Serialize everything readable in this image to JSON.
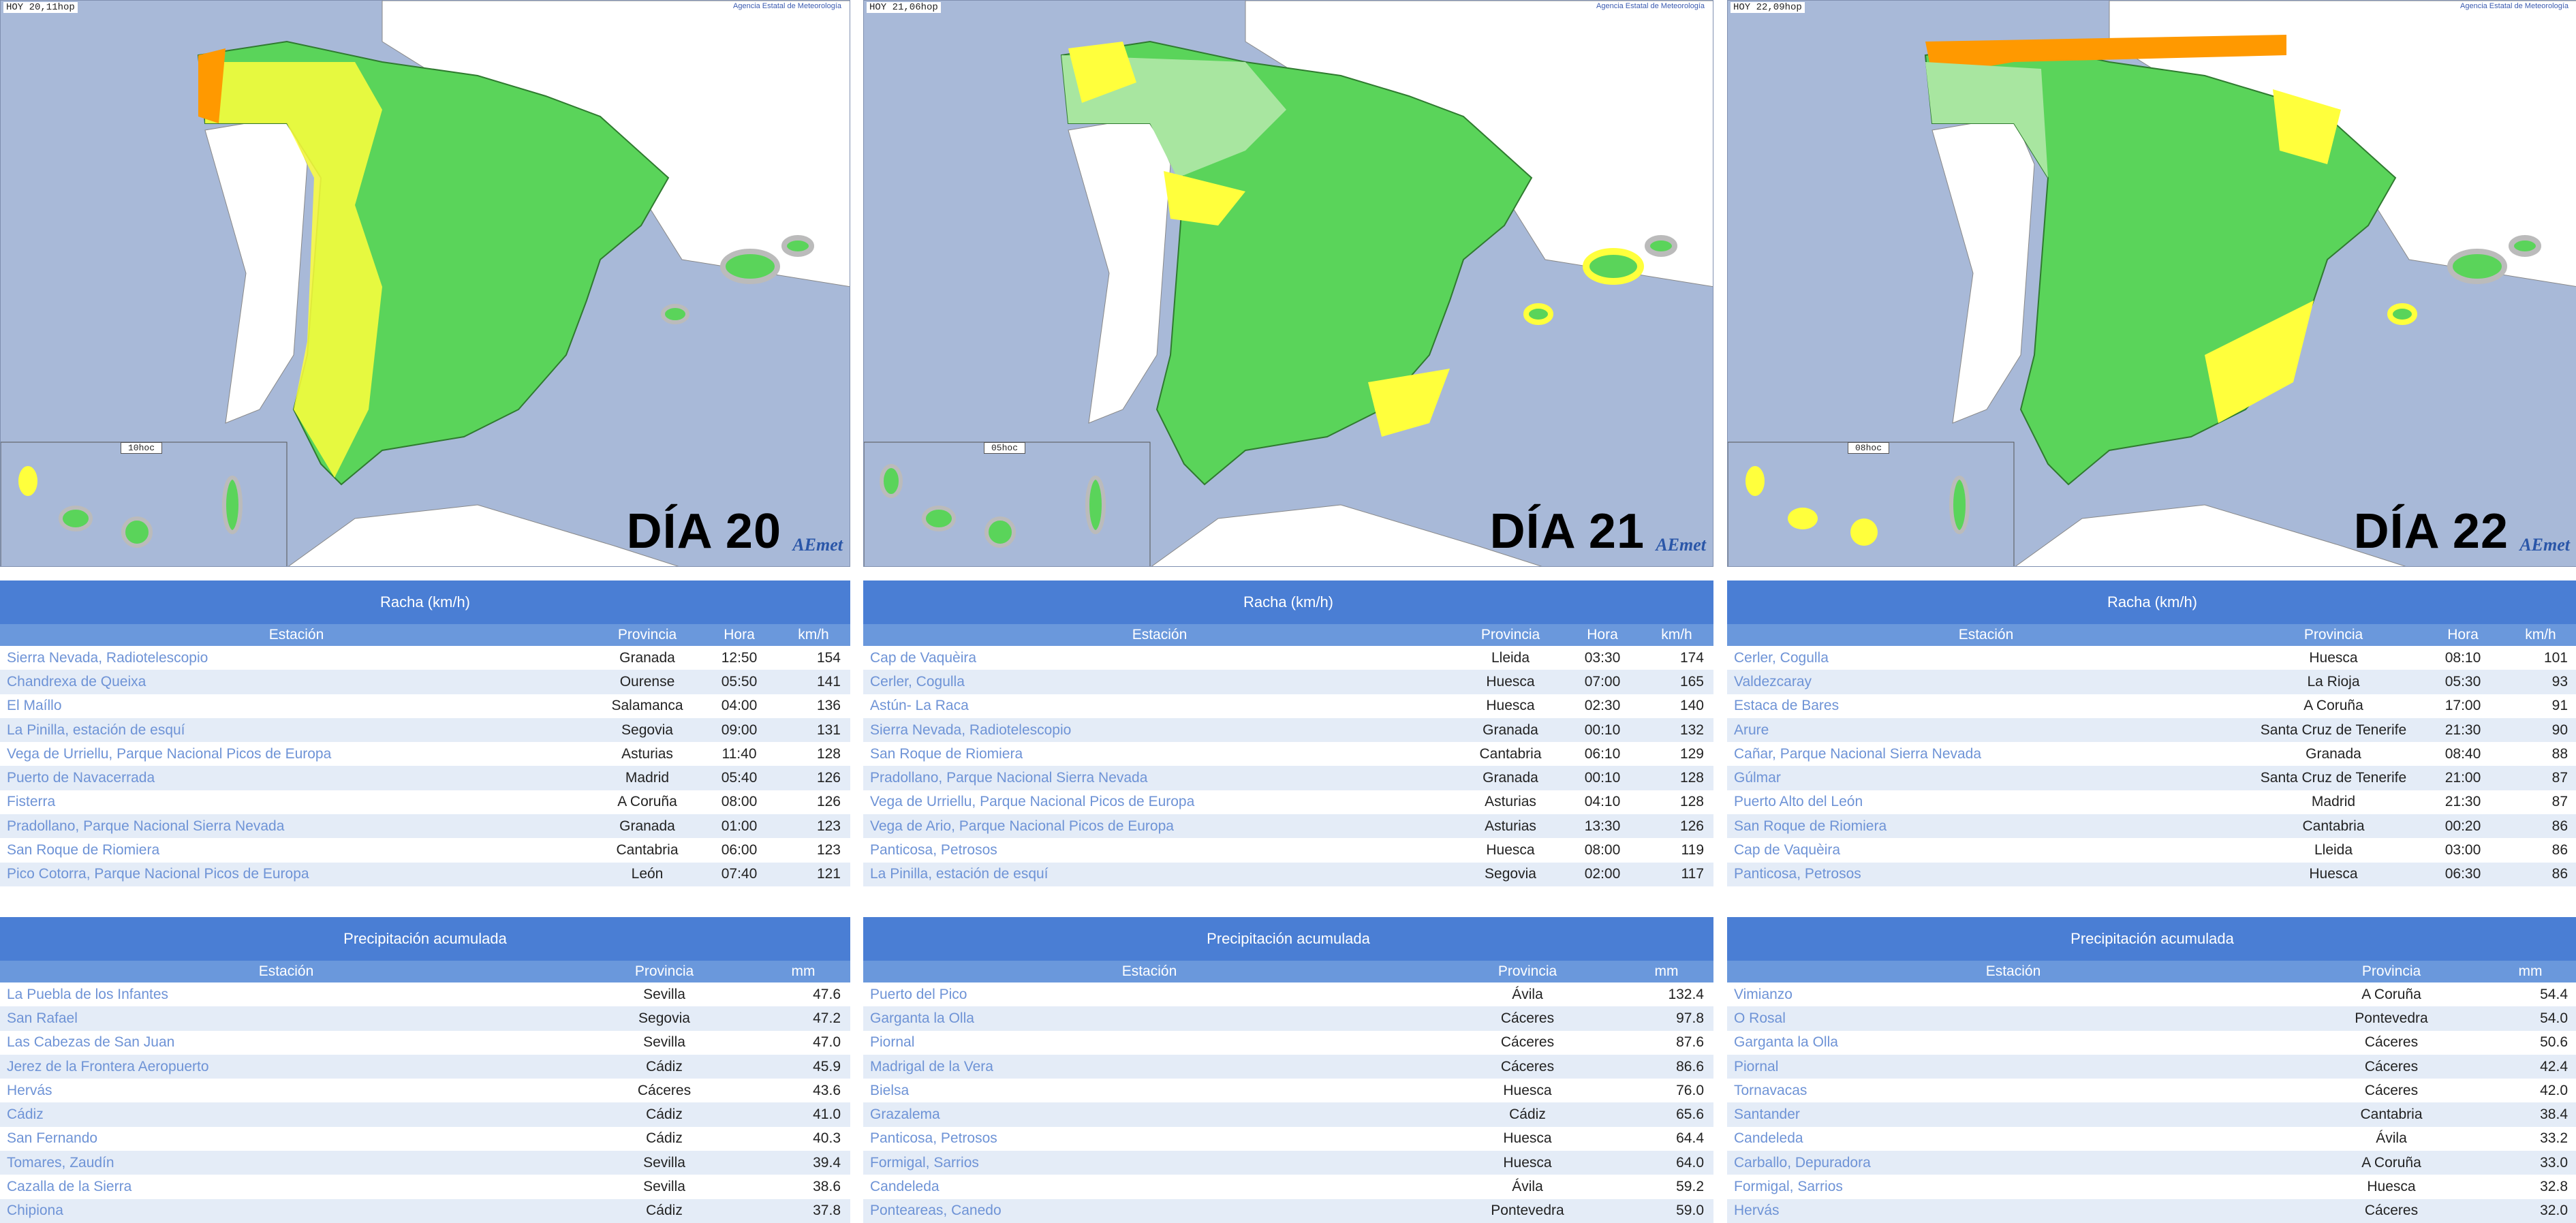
{
  "days": [
    {
      "map": {
        "header": "HOY 20,11hop",
        "agency": "Agencia Estatal de Meteorología",
        "inset": "10hoc",
        "day_label": "DÍA 20",
        "logo": "AEmet"
      },
      "wind": {
        "title": "Racha (km/h)",
        "headers": [
          "Estación",
          "Provincia",
          "Hora",
          "km/h"
        ],
        "rows": [
          [
            "Sierra Nevada, Radiotelescopio",
            "Granada",
            "12:50",
            "154"
          ],
          [
            "Chandrexa de Queixa",
            "Ourense",
            "05:50",
            "141"
          ],
          [
            "El Maíllo",
            "Salamanca",
            "04:00",
            "136"
          ],
          [
            "La Pinilla, estación de esquí",
            "Segovia",
            "09:00",
            "131"
          ],
          [
            "Vega de Urriellu, Parque Nacional Picos de Europa",
            "Asturias",
            "11:40",
            "128"
          ],
          [
            "Puerto de Navacerrada",
            "Madrid",
            "05:40",
            "126"
          ],
          [
            "Fisterra",
            "A Coruña",
            "08:00",
            "126"
          ],
          [
            "Pradollano, Parque Nacional Sierra Nevada",
            "Granada",
            "01:00",
            "123"
          ],
          [
            "San Roque de Riomiera",
            "Cantabria",
            "06:00",
            "123"
          ],
          [
            "Pico Cotorra, Parque Nacional Picos de Europa",
            "León",
            "07:40",
            "121"
          ]
        ]
      },
      "rain": {
        "title": "Precipitación acumulada",
        "headers": [
          "Estación",
          "Provincia",
          "mm"
        ],
        "rows": [
          [
            "La Puebla de los Infantes",
            "Sevilla",
            "47.6"
          ],
          [
            "San Rafael",
            "Segovia",
            "47.2"
          ],
          [
            "Las Cabezas de San Juan",
            "Sevilla",
            "47.0"
          ],
          [
            "Jerez de la Frontera Aeropuerto",
            "Cádiz",
            "45.9"
          ],
          [
            "Hervás",
            "Cáceres",
            "43.6"
          ],
          [
            "Cádiz",
            "Cádiz",
            "41.0"
          ],
          [
            "San Fernando",
            "Cádiz",
            "40.3"
          ],
          [
            "Tomares, Zaudín",
            "Sevilla",
            "39.4"
          ],
          [
            "Cazalla de la Sierra",
            "Sevilla",
            "38.6"
          ],
          [
            "Chipiona",
            "Cádiz",
            "37.8"
          ]
        ]
      }
    },
    {
      "map": {
        "header": "HOY 21,06hop",
        "agency": "Agencia Estatal de Meteorología",
        "inset": "05hoc",
        "day_label": "DÍA 21",
        "logo": "AEmet"
      },
      "wind": {
        "title": "Racha (km/h)",
        "headers": [
          "Estación",
          "Provincia",
          "Hora",
          "km/h"
        ],
        "rows": [
          [
            "Cap de Vaquèira",
            "Lleida",
            "03:30",
            "174"
          ],
          [
            "Cerler, Cogulla",
            "Huesca",
            "07:00",
            "165"
          ],
          [
            "Astún- La Raca",
            "Huesca",
            "02:30",
            "140"
          ],
          [
            "Sierra Nevada, Radiotelescopio",
            "Granada",
            "00:10",
            "132"
          ],
          [
            "San Roque de Riomiera",
            "Cantabria",
            "06:10",
            "129"
          ],
          [
            "Pradollano, Parque Nacional Sierra Nevada",
            "Granada",
            "00:10",
            "128"
          ],
          [
            "Vega de Urriellu, Parque Nacional Picos de Europa",
            "Asturias",
            "04:10",
            "128"
          ],
          [
            "Vega de Ario, Parque Nacional Picos de Europa",
            "Asturias",
            "13:30",
            "126"
          ],
          [
            "Panticosa, Petrosos",
            "Huesca",
            "08:00",
            "119"
          ],
          [
            "La Pinilla, estación de esquí",
            "Segovia",
            "02:00",
            "117"
          ]
        ]
      },
      "rain": {
        "title": "Precipitación acumulada",
        "headers": [
          "Estación",
          "Provincia",
          "mm"
        ],
        "rows": [
          [
            "Puerto del Pico",
            "Ávila",
            "132.4"
          ],
          [
            "Garganta la Olla",
            "Cáceres",
            "97.8"
          ],
          [
            "Piornal",
            "Cáceres",
            "87.6"
          ],
          [
            "Madrigal de la Vera",
            "Cáceres",
            "86.6"
          ],
          [
            "Bielsa",
            "Huesca",
            "76.0"
          ],
          [
            "Grazalema",
            "Cádiz",
            "65.6"
          ],
          [
            "Panticosa, Petrosos",
            "Huesca",
            "64.4"
          ],
          [
            "Formigal, Sarrios",
            "Huesca",
            "64.0"
          ],
          [
            "Candeleda",
            "Ávila",
            "59.2"
          ],
          [
            "Ponteareas, Canedo",
            "Pontevedra",
            "59.0"
          ]
        ]
      }
    },
    {
      "map": {
        "header": "HOY 22,09hop",
        "agency": "Agencia Estatal de Meteorología",
        "inset": "08hoc",
        "day_label": "DÍA 22",
        "logo": "AEmet"
      },
      "wind": {
        "title": "Racha (km/h)",
        "headers": [
          "Estación",
          "Provincia",
          "Hora",
          "km/h"
        ],
        "rows": [
          [
            "Cerler, Cogulla",
            "Huesca",
            "08:10",
            "101"
          ],
          [
            "Valdezcaray",
            "La Rioja",
            "05:30",
            "93"
          ],
          [
            "Estaca de Bares",
            "A Coruña",
            "17:00",
            "91"
          ],
          [
            "Arure",
            "Santa Cruz de Tenerife",
            "21:30",
            "90"
          ],
          [
            "Cañar, Parque Nacional Sierra Nevada",
            "Granada",
            "08:40",
            "88"
          ],
          [
            "Gúlmar",
            "Santa Cruz de Tenerife",
            "21:00",
            "87"
          ],
          [
            "Puerto Alto del León",
            "Madrid",
            "21:30",
            "87"
          ],
          [
            "San Roque de Riomiera",
            "Cantabria",
            "00:20",
            "86"
          ],
          [
            "Cap de Vaquèira",
            "Lleida",
            "03:00",
            "86"
          ],
          [
            "Panticosa, Petrosos",
            "Huesca",
            "06:30",
            "86"
          ]
        ]
      },
      "rain": {
        "title": "Precipitación acumulada",
        "headers": [
          "Estación",
          "Provincia",
          "mm"
        ],
        "rows": [
          [
            "Vimianzo",
            "A Coruña",
            "54.4"
          ],
          [
            "O Rosal",
            "Pontevedra",
            "54.0"
          ],
          [
            "Garganta la Olla",
            "Cáceres",
            "50.6"
          ],
          [
            "Piornal",
            "Cáceres",
            "42.4"
          ],
          [
            "Tornavacas",
            "Cáceres",
            "42.0"
          ],
          [
            "Santander",
            "Cantabria",
            "38.4"
          ],
          [
            "Candeleda",
            "Ávila",
            "33.2"
          ],
          [
            "Carballo, Depuradora",
            "A Coruña",
            "33.0"
          ],
          [
            "Formigal, Sarrios",
            "Huesca",
            "32.8"
          ],
          [
            "Hervás",
            "Cáceres",
            "32.0"
          ]
        ]
      }
    }
  ],
  "colors": {
    "sea": "#a8b9d8",
    "land_green": "#5ad45a",
    "light_green": "#a8e6a0",
    "yellow_warning": "#ffff3c",
    "orange_warning": "#ff9900",
    "table_header": "#4a7ed4",
    "station_link": "#6e93d6"
  }
}
